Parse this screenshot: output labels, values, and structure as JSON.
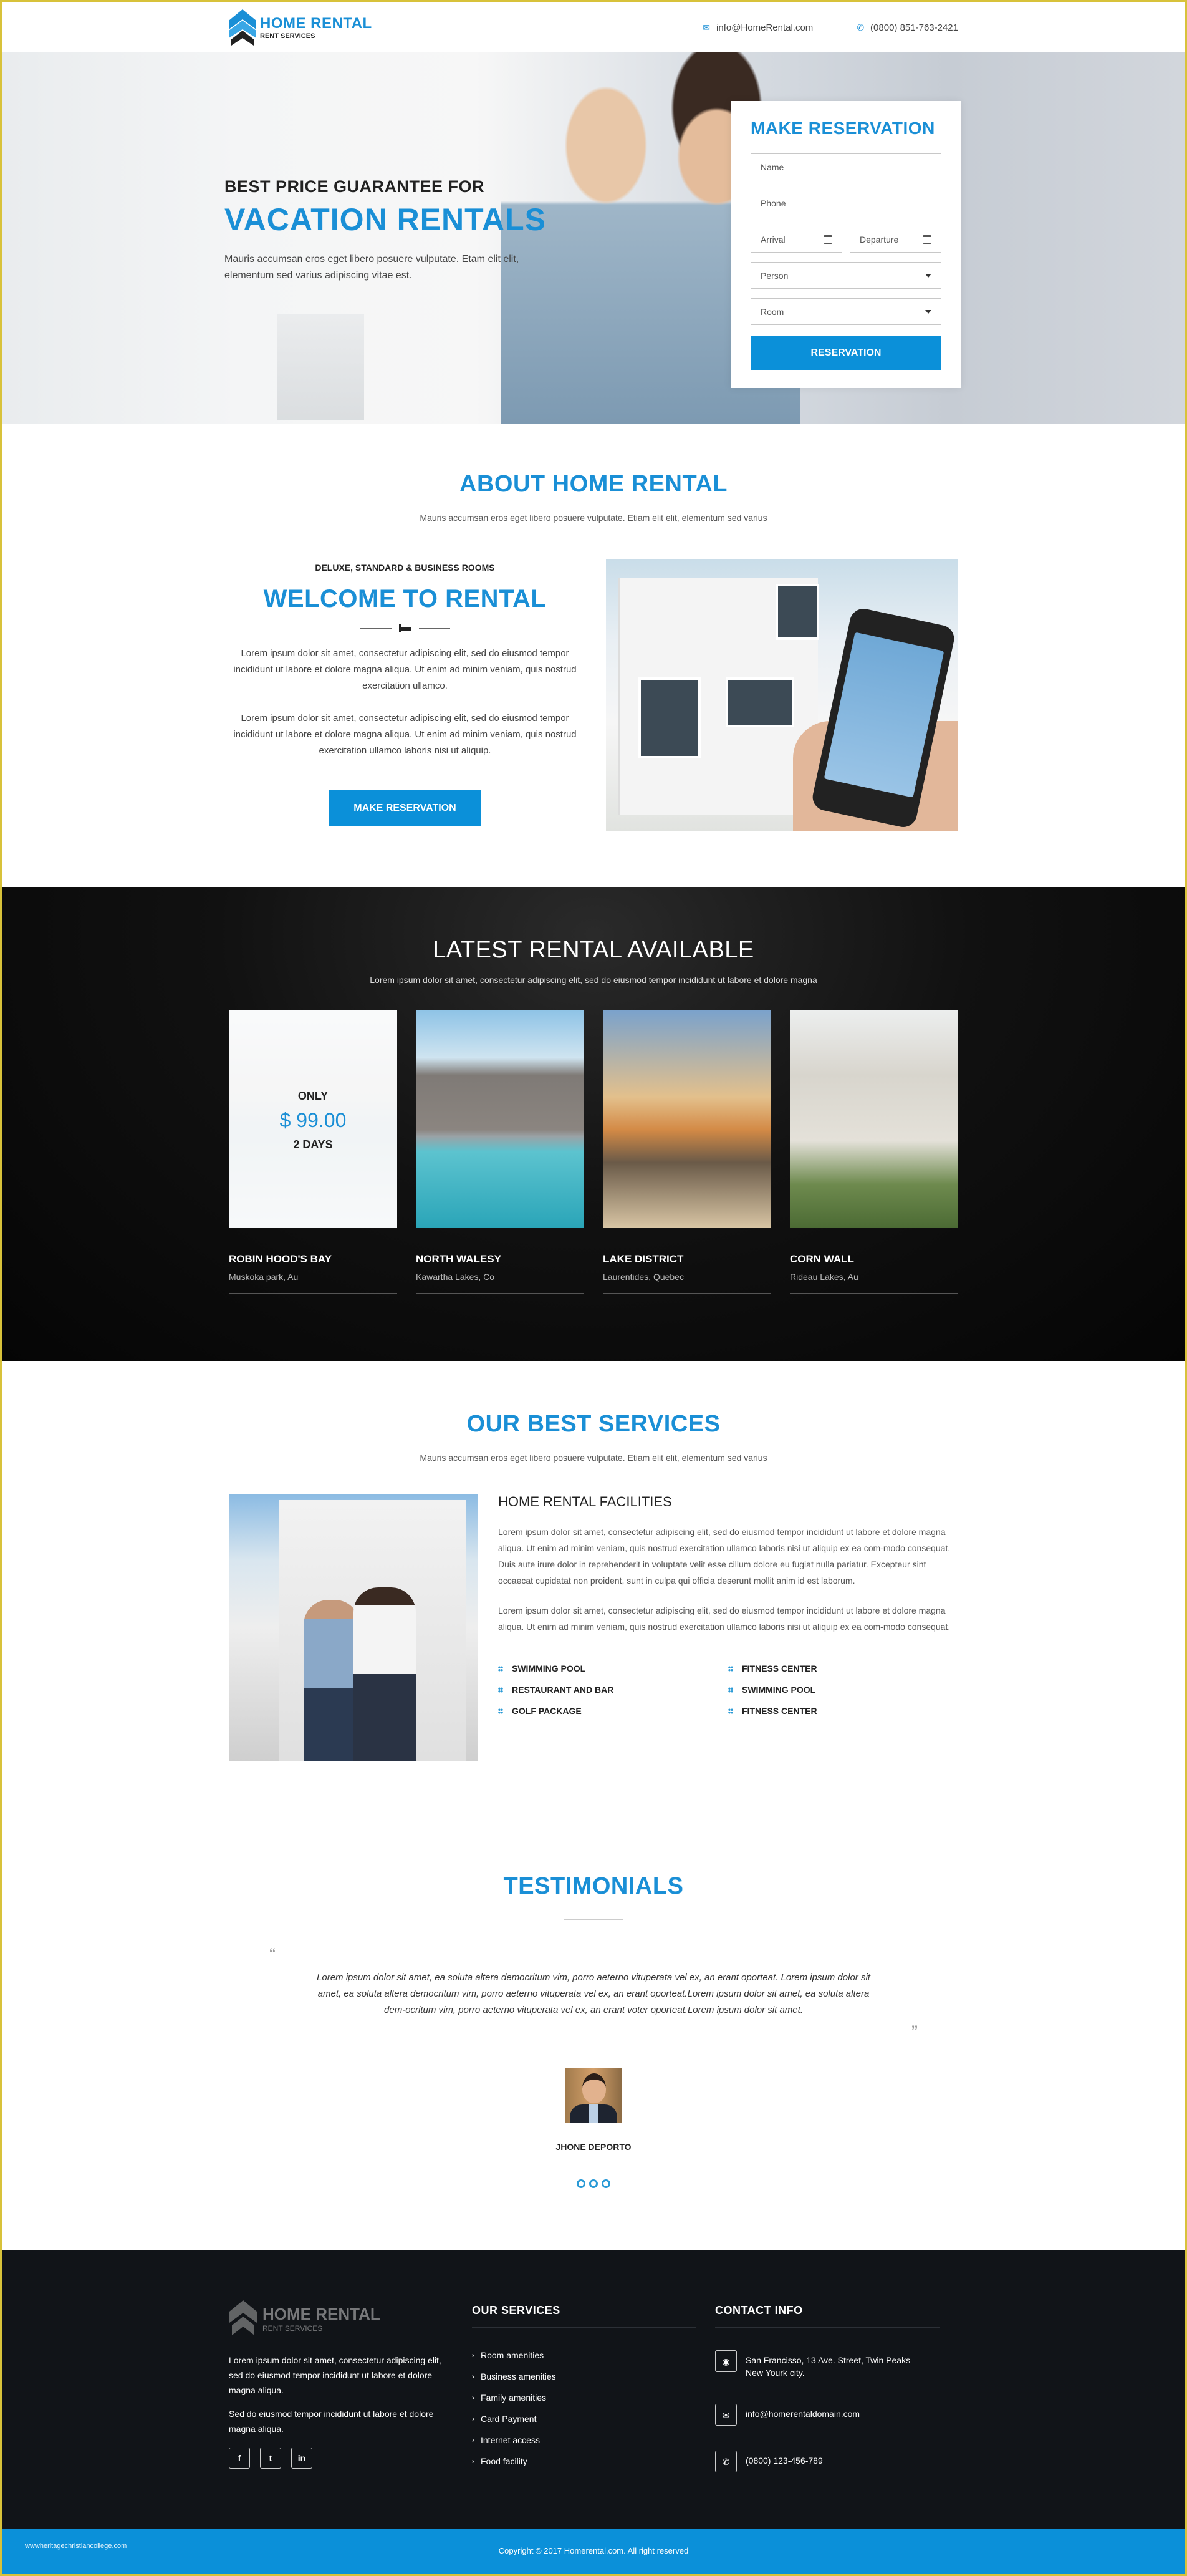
{
  "header": {
    "logo_title": "HOME RENTAL",
    "logo_subtitle": "RENT SERVICES",
    "email": "info@HomeRental.com",
    "phone": "(0800) 851-763-2421",
    "icons": {
      "email": "envelope-icon",
      "phone": "phone-icon"
    }
  },
  "hero": {
    "pretitle": "BEST PRICE GUARANTEE FOR",
    "title": "VACATION RENTALS",
    "description": "Mauris accumsan eros eget libero posuere vulputate. Etam elit elit, elementum sed varius adipiscing vitae est.",
    "form": {
      "title": "MAKE RESERVATION",
      "name_placeholder": "Name",
      "phone_placeholder": "Phone",
      "arrival_placeholder": "Arrival",
      "departure_placeholder": "Departure",
      "person_selected": "Person",
      "room_selected": "Room",
      "submit_label": "RESERVATION"
    }
  },
  "about": {
    "title": "ABOUT HOME RENTAL",
    "subtitle": "Mauris accumsan eros eget libero posuere vulputate. Etiam elit elit, elementum sed varius",
    "kicker": "DELUXE, STANDARD & BUSINESS ROOMS",
    "heading": "WELCOME TO RENTAL",
    "paragraphs": [
      "Lorem ipsum dolor sit amet, consectetur adipiscing elit, sed do eiusmod tempor incididunt ut labore et dolore magna aliqua. Ut enim ad minim veniam, quis nostrud exercitation ullamco.",
      "Lorem ipsum dolor sit amet, consectetur adipiscing elit, sed do eiusmod tempor incididunt ut labore et dolore magna aliqua. Ut enim ad minim veniam, quis nostrud exercitation ullamco laboris nisi ut aliquip."
    ],
    "button_label": "MAKE RESERVATION"
  },
  "latest": {
    "title": "LATEST RENTAL AVAILABLE",
    "subtitle": "Lorem ipsum dolor sit amet, consectetur adipiscing elit, sed do eiusmod tempor incididunt ut labore et dolore magna",
    "promo": {
      "only": "ONLY",
      "price": "$ 99.00",
      "days": "2 DAYS"
    },
    "cards": [
      {
        "name": "ROBIN HOOD'S BAY",
        "location": "Muskoka park, Au"
      },
      {
        "name": "NORTH WALESY",
        "location": "Kawartha Lakes, Co"
      },
      {
        "name": "LAKE DISTRICT",
        "location": "Laurentides, Quebec"
      },
      {
        "name": "CORN WALL",
        "location": "Rideau Lakes, Au"
      }
    ]
  },
  "services": {
    "title": "OUR BEST SERVICES",
    "subtitle": "Mauris accumsan eros eget libero posuere vulputate. Etiam elit elit, elementum sed varius",
    "heading": "HOME RENTAL FACILITIES",
    "paragraphs": [
      "Lorem ipsum dolor sit amet, consectetur adipiscing elit, sed do eiusmod tempor incididunt ut labore et dolore magna aliqua. Ut enim ad minim veniam, quis nostrud exercitation ullamco laboris nisi ut aliquip ex ea com-modo consequat. Duis aute irure dolor in reprehenderit in voluptate velit esse cillum dolore eu fugiat nulla pariatur. Excepteur sint occaecat cupidatat non proident, sunt in culpa qui officia deserunt mollit anim id est laborum.",
      "Lorem ipsum dolor sit amet, consectetur adipiscing elit, sed do eiusmod tempor incididunt ut labore et dolore magna aliqua. Ut enim ad minim veniam, quis nostrud exercitation ullamco laboris nisi ut aliquip ex ea com-modo consequat."
    ],
    "facilities": [
      "SWIMMING POOL",
      "FITNESS CENTER",
      "RESTAURANT AND BAR",
      "SWIMMING POOL",
      "GOLF PACKAGE",
      "FITNESS CENTER"
    ]
  },
  "testimonials": {
    "title": "TESTIMONIALS",
    "quote": "Lorem ipsum dolor sit amet, ea soluta altera democritum vim, porro aeterno vituperata vel ex, an erant oporteat. Lorem ipsum dolor sit amet, ea soluta altera democritum vim, porro aeterno vituperata vel ex, an erant oporteat.Lorem ipsum dolor sit amet, ea soluta altera dem-ocritum vim, porro aeterno vituperata vel ex, an erant  voter oporteat.Lorem ipsum dolor sit amet.",
    "open_quote": "“",
    "close_quote": "”",
    "author": "JHONE DEPORTO",
    "pages": 3
  },
  "footer": {
    "logo_title": "HOME RENTAL",
    "logo_subtitle": "RENT SERVICES",
    "about_paragraphs": [
      "Lorem ipsum dolor sit amet, consectetur adipiscing elit, sed do eiusmod tempor incididunt ut labore et dolore magna aliqua.",
      "Sed do eiusmod tempor incididunt ut labore et dolore magna aliqua."
    ],
    "social": [
      {
        "icon": "facebook-icon",
        "glyph": "f"
      },
      {
        "icon": "twitter-icon",
        "glyph": "t"
      },
      {
        "icon": "linkedin-icon",
        "glyph": "in"
      }
    ],
    "services_title": "OUR SERVICES",
    "services": [
      "Room amenities",
      "Business amenities",
      "Family amenities",
      "Card Payment",
      "Internet access",
      "Food facility"
    ],
    "contact_title": "CONTACT INFO",
    "address_line1": "San Francisso, 13 Ave. Street, Twin Peaks",
    "address_line2": "New Yourk city.",
    "email": "info@homerentaldomain.com",
    "phone": "(0800) 123-456-789"
  },
  "bottom_bar": {
    "watermark": "wwwheritagechristiancollege.com",
    "copyright": "Copyright ©  2017 Homerental.com. All right reserved"
  },
  "colors": {
    "accent": "#1a8fd6",
    "button": "#0b90d9",
    "footer_bg": "#111418",
    "dark_section": "#0a0a0a"
  }
}
